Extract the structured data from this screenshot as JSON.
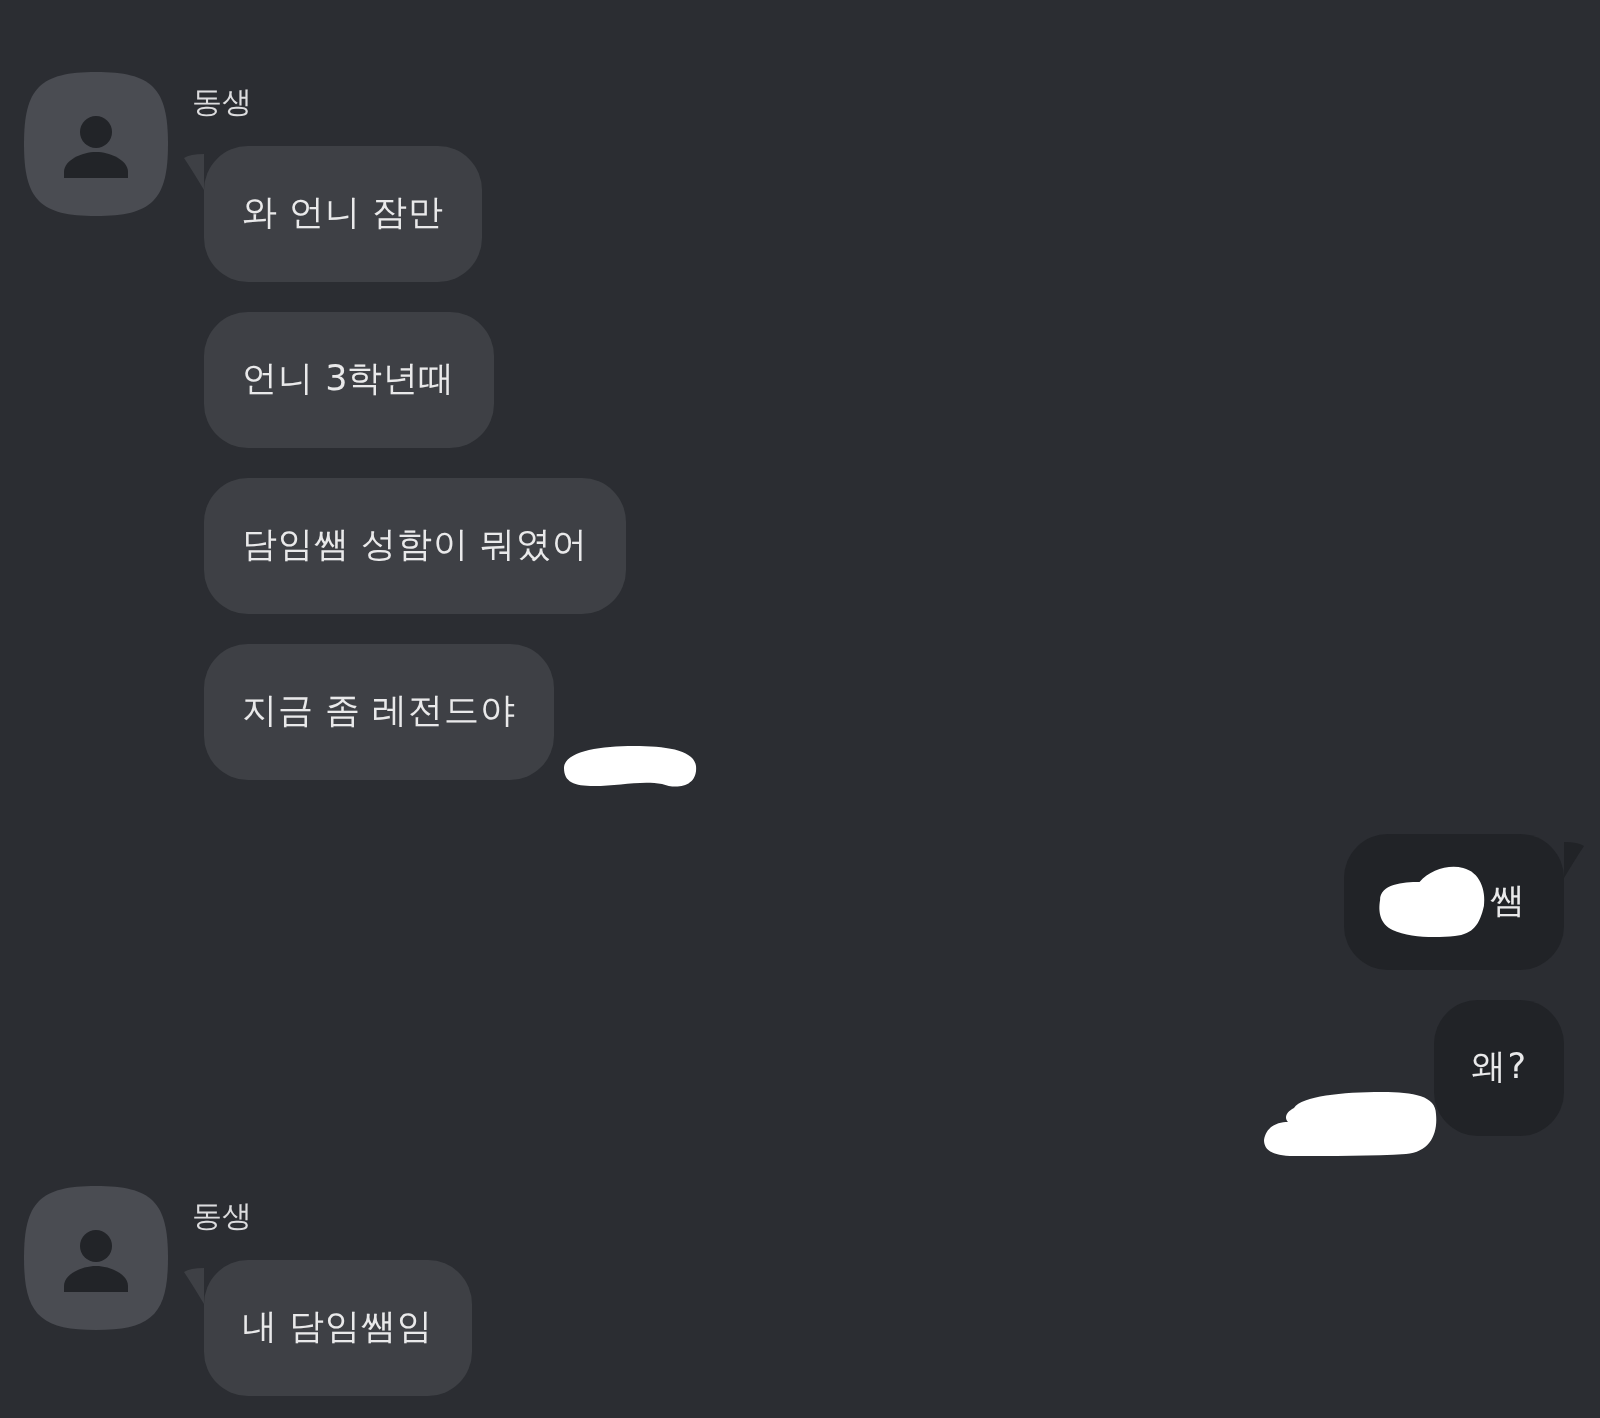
{
  "chat": [
    {
      "kind": "received",
      "sender": "동생",
      "bubbles": [
        {
          "text": "와 언니 잠만",
          "tail": true,
          "scribble_over_text": false,
          "scribble_beside": false
        },
        {
          "text": "언니 3학년때",
          "tail": false,
          "scribble_over_text": false,
          "scribble_beside": false
        },
        {
          "text": "담임쌤 성함이 뭐였어",
          "tail": false,
          "scribble_over_text": false,
          "scribble_beside": false
        },
        {
          "text": "지금 좀 레전드야",
          "tail": false,
          "scribble_over_text": false,
          "scribble_beside": true
        }
      ]
    },
    {
      "kind": "sent",
      "bubbles": [
        {
          "text": "쌤",
          "tail": true,
          "scribble_over_text": true,
          "scribble_beside": false
        },
        {
          "text": "왜?",
          "tail": false,
          "scribble_over_text": false,
          "scribble_beside": true
        }
      ]
    },
    {
      "kind": "received",
      "sender": "동생",
      "bubbles": [
        {
          "text": "내 담임쌤임",
          "tail": true,
          "scribble_over_text": false,
          "scribble_beside": false
        }
      ]
    }
  ]
}
